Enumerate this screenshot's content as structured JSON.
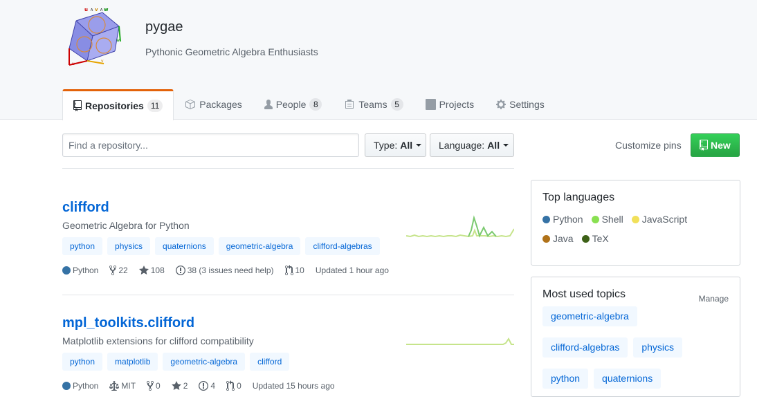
{
  "org": {
    "name": "pygae",
    "description": "Pythonic Geometric Algebra Enthusiasts",
    "logo_letters": [
      "u",
      "∧",
      "v",
      "∧",
      "w"
    ]
  },
  "tabs": [
    {
      "label": "Repositories",
      "count": "11",
      "icon": "repo-icon"
    },
    {
      "label": "Packages",
      "icon": "package-icon"
    },
    {
      "label": "People",
      "count": "8",
      "icon": "person-icon"
    },
    {
      "label": "Teams",
      "count": "5",
      "icon": "people-icon"
    },
    {
      "label": "Projects",
      "icon": "project-icon"
    },
    {
      "label": "Settings",
      "icon": "gear-icon"
    }
  ],
  "filters": {
    "search_placeholder": "Find a repository...",
    "type_label": "Type:",
    "type_value": "All",
    "language_label": "Language:",
    "language_value": "All",
    "customize_pins": "Customize pins",
    "new_button": "New"
  },
  "repos": [
    {
      "name": "clifford",
      "description": "Geometric Algebra for Python",
      "topics": [
        "python",
        "physics",
        "quaternions",
        "geometric-algebra",
        "clifford-algebras"
      ],
      "language": "Python",
      "language_color": "#3572A5",
      "forks": "22",
      "stars": "108",
      "issues": "38 (3 issues need help)",
      "pull_requests": "10",
      "updated": "Updated 1 hour ago"
    },
    {
      "name": "mpl_toolkits.clifford",
      "description": "Matplotlib extensions for clifford compatibility",
      "topics": [
        "python",
        "matplotlib",
        "geometric-algebra",
        "clifford"
      ],
      "language": "Python",
      "language_color": "#3572A5",
      "license": "MIT",
      "forks": "0",
      "stars": "2",
      "issues": "4",
      "pull_requests": "0",
      "updated": "Updated 15 hours ago"
    }
  ],
  "sidebar": {
    "top_languages": {
      "title": "Top languages",
      "items": [
        {
          "name": "Python",
          "color": "#3572A5"
        },
        {
          "name": "Shell",
          "color": "#89e051"
        },
        {
          "name": "JavaScript",
          "color": "#f1e05a"
        },
        {
          "name": "Java",
          "color": "#b07219"
        },
        {
          "name": "TeX",
          "color": "#3D6117"
        }
      ]
    },
    "topics": {
      "title": "Most used topics",
      "manage": "Manage",
      "items": [
        "geometric-algebra",
        "clifford-algebras",
        "physics",
        "python",
        "quaternions"
      ]
    }
  }
}
